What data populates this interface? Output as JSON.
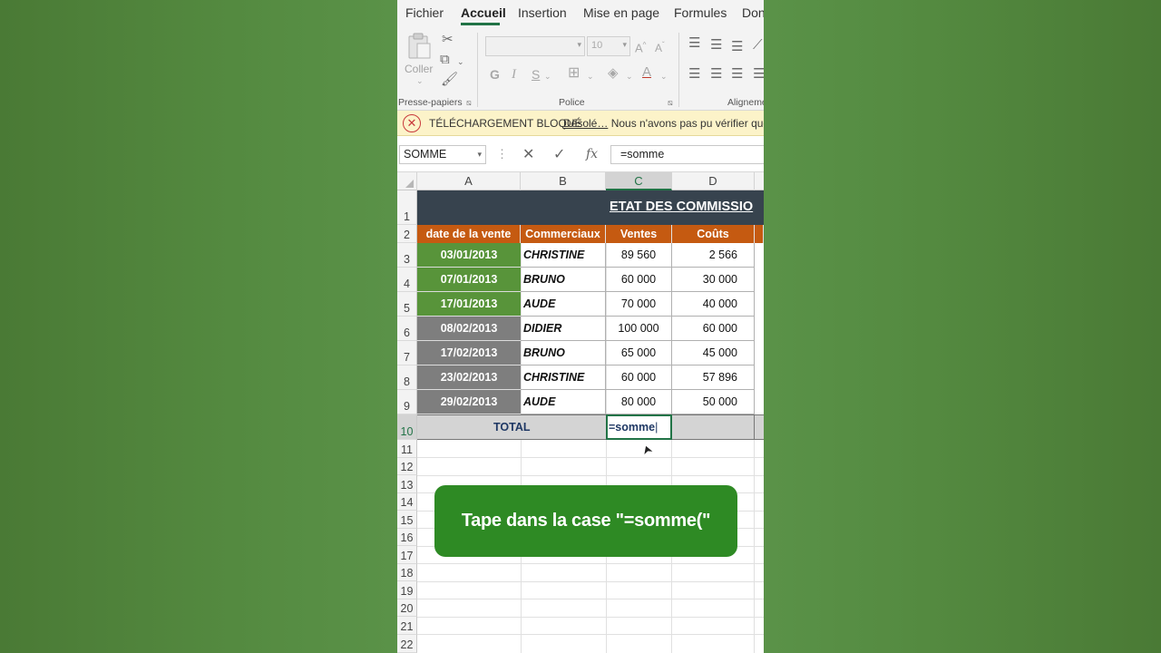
{
  "tabs": [
    "Fichier",
    "Accueil",
    "Insertion",
    "Mise en page",
    "Formules",
    "Don"
  ],
  "ribbon": {
    "clipboard_label": "Presse-papiers",
    "paste_label": "Coller",
    "font_group_label": "Police",
    "font_size": "10",
    "bold": "G",
    "italic": "I",
    "underline": "S",
    "align_group_label": "Aligneme"
  },
  "message_bar": {
    "title": "TÉLÉCHARGEMENT BLOQUÉ",
    "link": "Désolé…",
    "text": " Nous n'avons pas pu vérifier que"
  },
  "formula_bar": {
    "name_box": "SOMME",
    "cancel": "✕",
    "enter": "✓",
    "fx": "fx",
    "formula": "=somme"
  },
  "columns": [
    "A",
    "B",
    "C",
    "D"
  ],
  "rows": [
    "1",
    "2",
    "3",
    "4",
    "5",
    "6",
    "7",
    "8",
    "9",
    "10",
    "11",
    "12",
    "13",
    "14",
    "15",
    "16",
    "17",
    "18",
    "19",
    "20",
    "21",
    "22"
  ],
  "sheet": {
    "title": "ETAT DES COMMISSIO",
    "headers": [
      "date de la vente",
      "Commerciaux",
      "Ventes",
      "Coûts"
    ],
    "data": [
      {
        "date": "03/01/2013",
        "name": "CHRISTINE",
        "sales": "89 560",
        "cost": "2 566"
      },
      {
        "date": "07/01/2013",
        "name": "BRUNO",
        "sales": "60 000",
        "cost": "30 000"
      },
      {
        "date": "17/01/2013",
        "name": "AUDE",
        "sales": "70 000",
        "cost": "40 000"
      },
      {
        "date": "08/02/2013",
        "name": "DIDIER",
        "sales": "100 000",
        "cost": "60 000"
      },
      {
        "date": "17/02/2013",
        "name": "BRUNO",
        "sales": "65 000",
        "cost": "45 000"
      },
      {
        "date": "23/02/2013",
        "name": "CHRISTINE",
        "sales": "60 000",
        "cost": "57 896"
      },
      {
        "date": "29/02/2013",
        "name": "AUDE",
        "sales": "80 000",
        "cost": "50 000"
      }
    ],
    "total_label": "TOTAL",
    "active_input": "=somme"
  },
  "caption": "Tape dans la case \"=somme(\""
}
